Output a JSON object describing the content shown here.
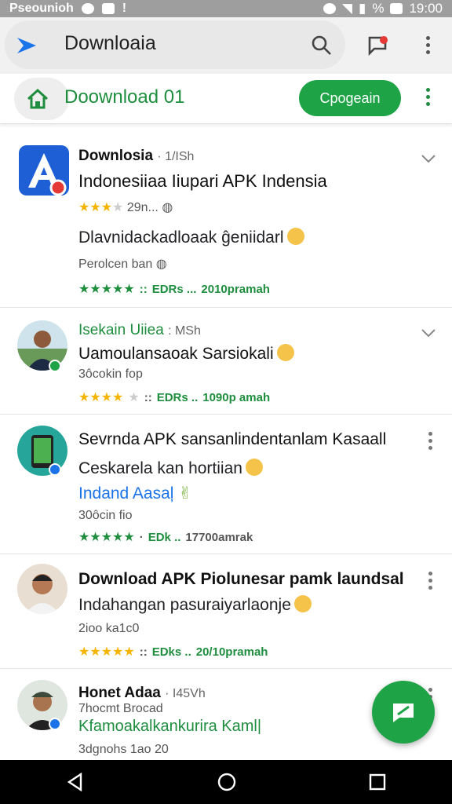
{
  "status_bar": {
    "carrier": "Pseounioh",
    "time": "19:00",
    "battery_label": "%"
  },
  "app_bar": {
    "title": "Downloaia"
  },
  "sub_bar": {
    "title": "Doownload 01",
    "open_button": "Cpogeain"
  },
  "items": [
    {
      "name": "Downlosia",
      "handle": "· 1/ISh",
      "headline": "Indonesiiaa Iiupari APK Indensia",
      "rating_extra": "29n...",
      "line3": "Dlavnidackadloaak ĝeniidarl",
      "line4": "Perolcen ban",
      "meta_a": "EDRs ...",
      "meta_b": "2010pramah"
    },
    {
      "name": "Isekain Uiiea",
      "handle": ": MSh",
      "headline": "Uamoulansaoak Sarsiokali",
      "line4": "3ôcokin fop",
      "meta_a": "EDRs ..",
      "meta_b": "1090p amah"
    },
    {
      "headline": "Sevrnda APK sansanlindentanlam Kasaall",
      "line2": "Ceskarela kan hortiian",
      "link": "Indand Aasaļ",
      "line4": "30ôcin fio",
      "meta_a": "EDk ..",
      "meta_b": "17700amrak"
    },
    {
      "headline": "Download APK Piolunesar pamk laundsal",
      "line2": "Indahangan pasuraiyarlaonje",
      "line3": "2ioo ka1c0",
      "meta_a": "EDks ..",
      "meta_b": "20/10pramah"
    },
    {
      "name": "Honet Adaa",
      "handle": "· I45Vh",
      "line2": "7hocmt Brocad",
      "greenlink": "Kfamoakalkankurira Kaml|",
      "line4": "3dgnohs 1ao 20"
    }
  ],
  "icons": {
    "logo": "play-store-logo-icon",
    "search": "search-icon",
    "chat": "chat-icon",
    "more": "more-vert-icon",
    "home": "home-icon",
    "fab": "compose-icon"
  },
  "colors": {
    "accent": "#1ea446",
    "link": "#1a73e8",
    "star": "#f4b400"
  }
}
